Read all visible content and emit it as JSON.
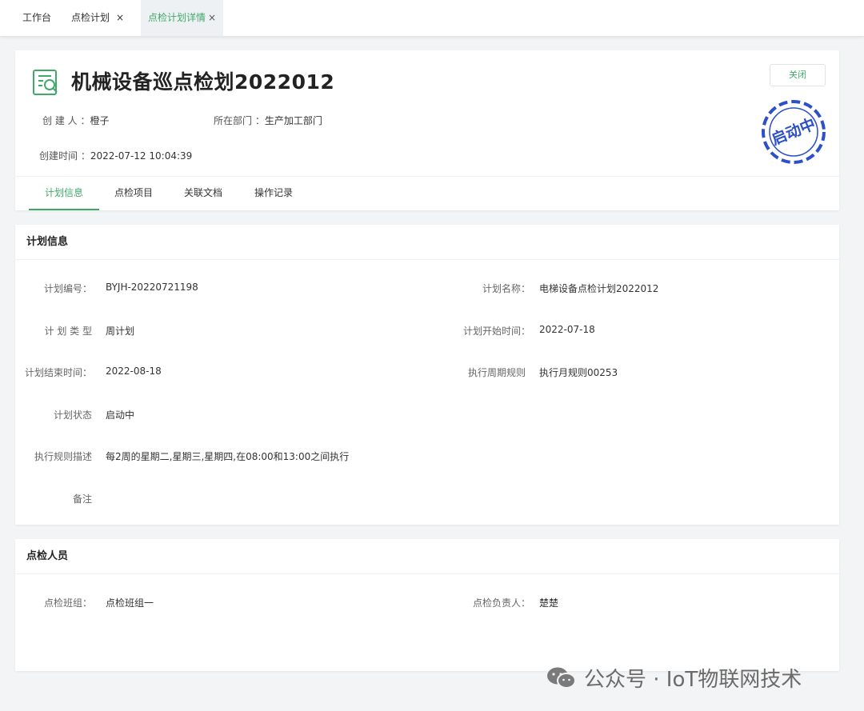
{
  "tabs": [
    {
      "label": "工作台"
    },
    {
      "label": "点检计划",
      "close": "×"
    },
    {
      "label": "点检计划详情",
      "close": "×"
    }
  ],
  "header": {
    "title": "机械设备巡点检划2022012",
    "creator_label": "创 建 人 ：",
    "creator": "橙子",
    "dept_label": "所在部门 ：",
    "dept": "生产加工部门",
    "created_label": "创建时间 ：",
    "created": "2022-07-12 10:04:39",
    "close_label": "关闭",
    "stamp": "启动中"
  },
  "subtabs": [
    "计划信息",
    "点检项目",
    "关联文档",
    "操作记录"
  ],
  "plan_info": {
    "title": "计划信息",
    "fields": [
      {
        "label": "计划编号：",
        "value": "BYJH-20220721198"
      },
      {
        "label": "计划名称：",
        "value": "电梯设备点检计划2022012"
      },
      {
        "label": "计 划 类 型",
        "value": "周计划"
      },
      {
        "label": "计划开始时间：",
        "value": "2022-07-18"
      },
      {
        "label": "计划结束时间：",
        "value": "2022-08-18"
      },
      {
        "label": "执行周期规则",
        "value": "执行月规则00253"
      },
      {
        "label": "计划状态",
        "value": "启动中"
      },
      {
        "label": "执行规则描述",
        "value": "每2周的星期二,星期三,星期四,在08:00和13:00之间执行"
      },
      {
        "label": "备注",
        "value": ""
      }
    ]
  },
  "staff": {
    "title": "点检人员",
    "fields": [
      {
        "label": "点检班组：",
        "value": "点检班组一"
      },
      {
        "label": "点检负责人：",
        "value": "楚楚"
      }
    ]
  },
  "watermark": "公众号 · IoT物联网技术",
  "colors": {
    "accent": "#3fa96a",
    "stamp": "#2c50c9"
  }
}
